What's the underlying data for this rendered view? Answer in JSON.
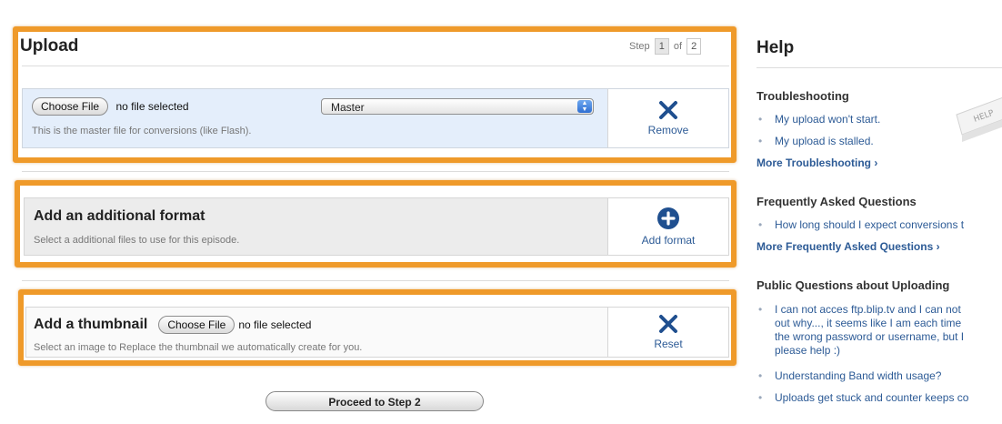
{
  "upload": {
    "title": "Upload",
    "step_label": "Step",
    "step_current": "1",
    "step_of": "of",
    "step_total": "2",
    "master_row": {
      "choose_file_label": "Choose File",
      "file_status": "no file selected",
      "format_select_value": "Master",
      "hint": "This is the master file for conversions (like Flash).",
      "remove_label": "Remove"
    }
  },
  "additional_format": {
    "title": "Add an additional format",
    "hint": "Select a additional files to use for this episode.",
    "add_label": "Add format"
  },
  "thumbnail": {
    "title": "Add a thumbnail",
    "choose_file_label": "Choose File",
    "file_status": "no file selected",
    "hint": "Select an image to Replace the thumbnail we automatically create for you.",
    "reset_label": "Reset"
  },
  "proceed_label": "Proceed to Step 2",
  "help": {
    "title": "Help",
    "troubleshooting": {
      "title": "Troubleshooting",
      "links": [
        "My upload won't start.",
        "My upload is stalled."
      ],
      "more": "More Troubleshooting ›"
    },
    "faq": {
      "title": "Frequently Asked Questions",
      "links": [
        "How long should I expect conversions t"
      ],
      "more": "More Frequently Asked Questions ›"
    },
    "public": {
      "title": "Public Questions about Uploading",
      "q1_lines": [
        "I can not acces ftp.blip.tv and I can not",
        "out why..., it seems like I am each time",
        "the wrong password or username, but I",
        "please help :)"
      ],
      "links": [
        "Understanding Band width usage?",
        "Uploads get stuck and counter keeps co"
      ]
    },
    "art_text": "HELP"
  },
  "colors": {
    "callout": "#ef9a2a",
    "link": "#2d5b96",
    "master_row_bg": "#e4eefb",
    "action_icon": "#1f4f8f"
  },
  "icons": {
    "remove": "close-x-icon",
    "add_format": "plus-circle-icon",
    "reset": "close-x-icon",
    "select_arrows": "up-down-arrows-icon"
  }
}
